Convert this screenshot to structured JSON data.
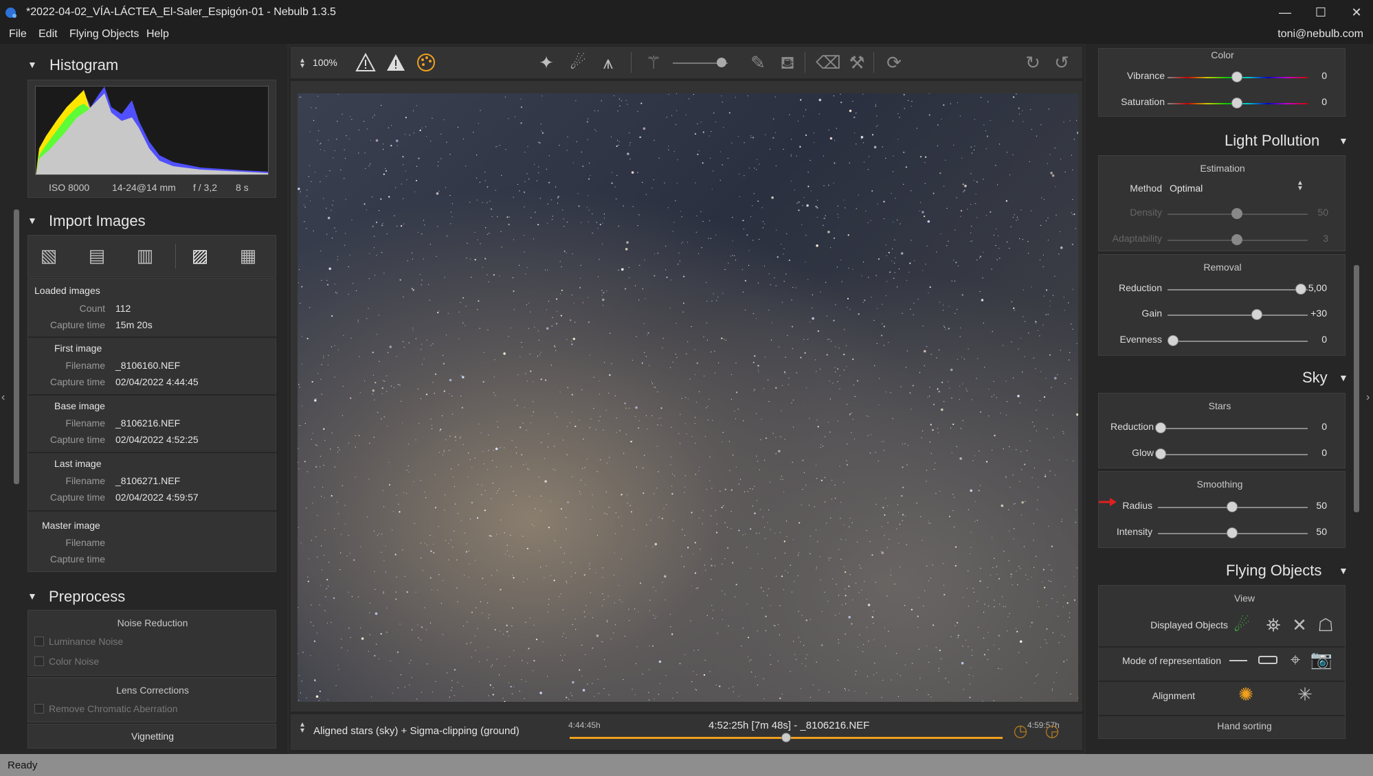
{
  "window": {
    "title": "*2022-04-02_VÍA-LÁCTEA_El-Saler_Espigón-01 - Nebulb 1.3.5",
    "minimize": "—",
    "maximize": "☐",
    "close": "✕"
  },
  "menu": {
    "file": "File",
    "edit": "Edit",
    "flying": "Flying Objects",
    "help": "Help",
    "user": "toni@nebulb.com"
  },
  "histogram": {
    "title": "Histogram",
    "iso": "ISO 8000",
    "lens": "14-24@14 mm",
    "aperture": "f / 3,2",
    "exposure": "8 s"
  },
  "import": {
    "title": "Import Images",
    "loaded": {
      "heading": "Loaded images",
      "count_label": "Count",
      "count": "112",
      "capture_label": "Capture time",
      "capture": "15m 20s"
    },
    "first": {
      "heading": "First image",
      "filename_label": "Filename",
      "filename": "_8106160.NEF",
      "capture_label": "Capture time",
      "capture": "02/04/2022 4:44:45"
    },
    "base": {
      "heading": "Base image",
      "filename_label": "Filename",
      "filename": "_8106216.NEF",
      "capture_label": "Capture time",
      "capture": "02/04/2022 4:52:25"
    },
    "last": {
      "heading": "Last image",
      "filename_label": "Filename",
      "filename": "_8106271.NEF",
      "capture_label": "Capture time",
      "capture": "02/04/2022 4:59:57"
    },
    "master": {
      "heading": "Master image",
      "filename_label": "Filename",
      "capture_label": "Capture time"
    }
  },
  "preprocess": {
    "title": "Preprocess",
    "noise_reduction": "Noise Reduction",
    "luminance": "Luminance Noise",
    "color": "Color Noise",
    "lens": "Lens Corrections",
    "chromatic": "Remove Chromatic Aberration",
    "vignetting": "Vignetting"
  },
  "toolbar": {
    "zoom": "100%"
  },
  "timeline": {
    "mode": "Aligned stars (sky) + Sigma-clipping (ground)",
    "start": "4:44:45h",
    "current": "4:52:25h [7m 48s] - _8106216.NEF",
    "end": "4:59:57h",
    "position": 0.5
  },
  "color": {
    "title": "Color",
    "vibrance_label": "Vibrance",
    "vibrance": "0",
    "saturation_label": "Saturation",
    "saturation": "0"
  },
  "light_pollution": {
    "title": "Light Pollution",
    "estimation": "Estimation",
    "method_label": "Method",
    "method": "Optimal",
    "density_label": "Density",
    "density": "50",
    "adaptability_label": "Adaptability",
    "adaptability": "3",
    "removal": "Removal",
    "reduction_label": "Reduction",
    "reduction": "5,00",
    "gain_label": "Gain",
    "gain": "+30",
    "evenness_label": "Evenness",
    "evenness": "0"
  },
  "sky": {
    "title": "Sky",
    "stars": "Stars",
    "reduction_label": "Reduction",
    "reduction": "0",
    "glow_label": "Glow",
    "glow": "0",
    "smoothing": "Smoothing",
    "radius_label": "Radius",
    "radius": "50",
    "intensity_label": "Intensity",
    "intensity": "50"
  },
  "flying_objects": {
    "title": "Flying Objects",
    "view": "View",
    "displayed_label": "Displayed Objects",
    "mode_label": "Mode of representation",
    "alignment_label": "Alignment",
    "hand_sorting": "Hand sorting"
  },
  "status": {
    "text": "Ready"
  },
  "colors": {
    "accent_orange": "#f0a020",
    "annotation_red": "#e02020"
  }
}
